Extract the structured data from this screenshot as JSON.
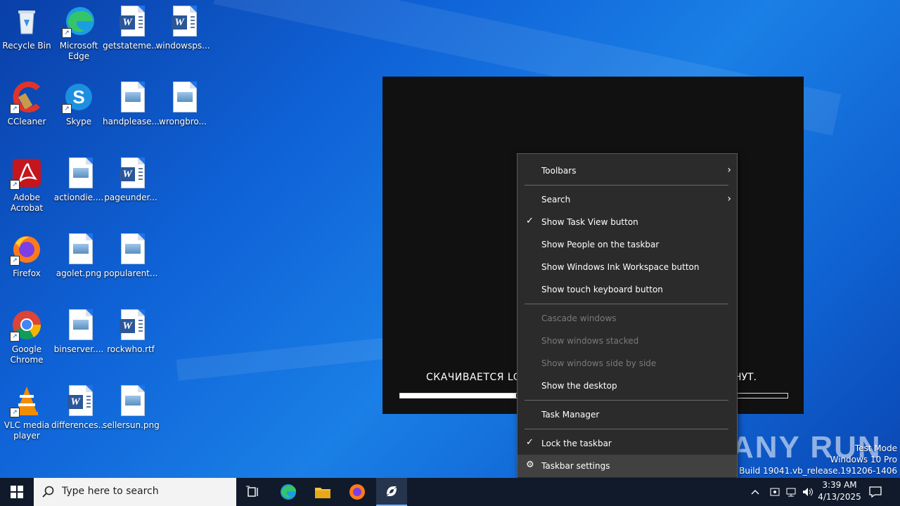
{
  "desktop": {
    "icons": [
      {
        "label": "Recycle Bin",
        "icon": "recycle-bin-icon"
      },
      {
        "label": "Microsoft Edge",
        "icon": "edge-icon"
      },
      {
        "label": "getstateme...",
        "icon": "word-doc-icon"
      },
      {
        "label": "windowsps...",
        "icon": "word-doc-icon"
      },
      {
        "label": "CCleaner",
        "icon": "ccleaner-icon"
      },
      {
        "label": "Skype",
        "icon": "skype-icon"
      },
      {
        "label": "handplease...",
        "icon": "image-file-icon"
      },
      {
        "label": "wrongbro...",
        "icon": "image-file-icon"
      },
      {
        "label": "Adobe Acrobat",
        "icon": "acrobat-icon"
      },
      {
        "label": "actiondie....",
        "icon": "image-file-icon"
      },
      {
        "label": "pageunder...",
        "icon": "word-doc-icon"
      },
      {
        "label": "Firefox",
        "icon": "firefox-icon"
      },
      {
        "label": "agolet.png",
        "icon": "image-file-icon"
      },
      {
        "label": "popularent...",
        "icon": "image-file-icon"
      },
      {
        "label": "Google Chrome",
        "icon": "chrome-icon"
      },
      {
        "label": "binserver....",
        "icon": "image-file-icon"
      },
      {
        "label": "rockwho.rtf",
        "icon": "word-doc-icon"
      },
      {
        "label": "VLC media player",
        "icon": "vlc-icon"
      },
      {
        "label": "differences...",
        "icon": "word-doc-icon"
      },
      {
        "label": "sellersun.png",
        "icon": "image-file-icon"
      }
    ]
  },
  "window": {
    "status_left": "СКАЧИВАЕТСЯ LO",
    "status_right": "НУТ.",
    "progress": 0.3
  },
  "context_menu": {
    "toolbars": "Toolbars",
    "search": "Search",
    "task_view": "Show Task View button",
    "people": "Show People on the taskbar",
    "ink": "Show Windows Ink Workspace button",
    "touch_kb": "Show touch keyboard button",
    "cascade": "Cascade windows",
    "stacked": "Show windows stacked",
    "side_by_side": "Show windows side by side",
    "show_desktop": "Show the desktop",
    "task_manager": "Task Manager",
    "lock": "Lock the taskbar",
    "settings": "Taskbar settings",
    "check": "✓",
    "arrow": "›",
    "gear": "⚙"
  },
  "watermark": "ANY RUN",
  "sysinfo": {
    "line1": "Test Mode",
    "line2": "Windows 10 Pro",
    "line3": "Build 19041.vb_release.191206-1406"
  },
  "taskbar": {
    "search_placeholder": "Type here to search",
    "time": "3:39 AM",
    "date": "4/13/2025"
  }
}
